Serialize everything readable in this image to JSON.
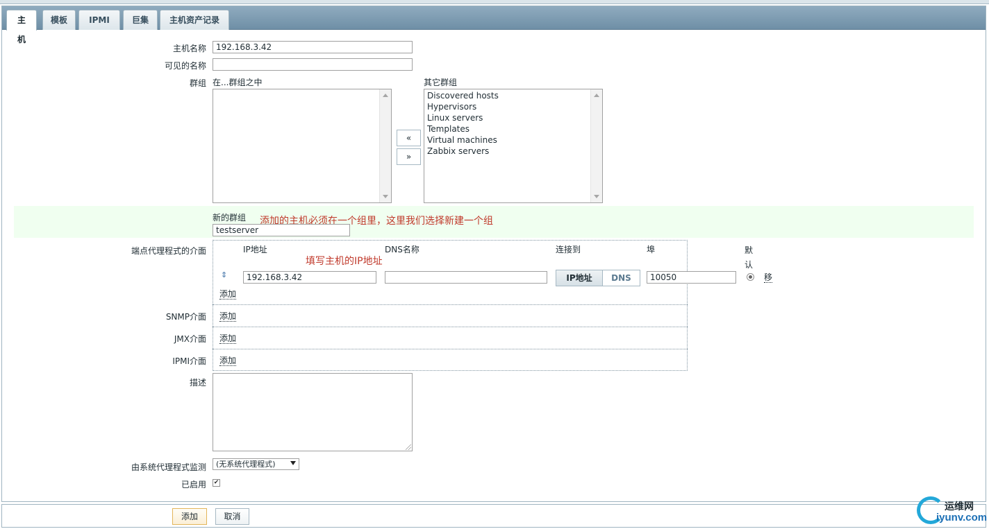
{
  "tabs": [
    {
      "label": "主机",
      "active": true
    },
    {
      "label": "模板",
      "active": false
    },
    {
      "label": "IPMI",
      "active": false
    },
    {
      "label": "巨集",
      "active": false
    },
    {
      "label": "主机资产记录",
      "active": false
    }
  ],
  "form": {
    "host_name": {
      "label": "主机名称",
      "value": "192.168.3.42"
    },
    "visible_name": {
      "label": "可见的名称",
      "value": ""
    },
    "groups": {
      "label": "群组",
      "in_groups_header": "在...群组之中",
      "other_groups_header": "其它群组",
      "in_groups": [],
      "other_groups": [
        "Discovered hosts",
        "Hypervisors",
        "Linux servers",
        "Templates",
        "Virtual machines",
        "Zabbix servers"
      ],
      "move_left": "«",
      "move_right": "»"
    },
    "new_group": {
      "label": "新的群组",
      "value": "testserver"
    },
    "agent_interfaces": {
      "label": "端点代理程式的介面",
      "columns": {
        "ip": "IP地址",
        "dns": "DNS名称",
        "connect_to": "连接到",
        "port": "埠",
        "default": "默认"
      },
      "row": {
        "ip": "192.168.3.42",
        "dns": "",
        "connect_ip": "IP地址",
        "connect_dns": "DNS",
        "port": "10050",
        "remove": "移"
      },
      "add": "添加"
    },
    "snmp_interfaces": {
      "label": "SNMP介面",
      "add": "添加"
    },
    "jmx_interfaces": {
      "label": "JMX介面",
      "add": "添加"
    },
    "ipmi_interfaces": {
      "label": "IPMI介面",
      "add": "添加"
    },
    "description": {
      "label": "描述",
      "value": ""
    },
    "proxy": {
      "label": "由系统代理程式监测",
      "value": "(无系统代理程式)"
    },
    "enabled": {
      "label": "已启用",
      "checked": true
    }
  },
  "annotations": {
    "group_note": "添加的主机必须在一个组里，这里我们选择新建一个组",
    "ip_note": "填写主机的IP地址"
  },
  "buttons": {
    "add": "添加",
    "cancel": "取消"
  },
  "watermark": {
    "name": "运维网",
    "domain": "iyunv.com"
  },
  "colors": {
    "annotation_red": "#c0392b",
    "new_group_bg": "#f0fff0",
    "tab_bar": "#7f9db3"
  }
}
